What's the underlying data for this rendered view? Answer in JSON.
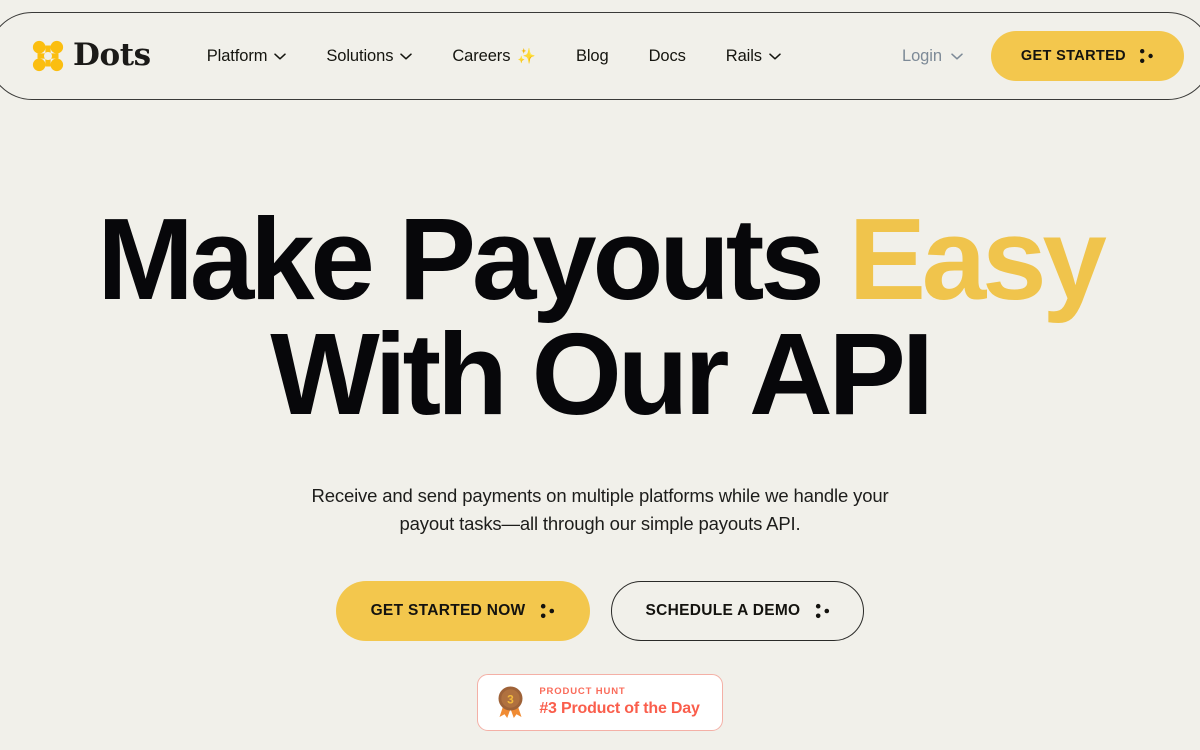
{
  "colors": {
    "page_background": "#F1F0EA",
    "accent_yellow": "#F3C74D",
    "headline_accent": "#F0C44C",
    "text_dark": "#07070A",
    "login_gray": "#7D8A97",
    "product_hunt_red": "#FA5E4C",
    "product_hunt_border": "#F4B0A6",
    "header_border": "#3A3A38"
  },
  "header": {
    "brand": {
      "name": "Dots",
      "logo_icon": "four-dots-cross-icon"
    },
    "nav": [
      {
        "label": "Platform",
        "has_dropdown": true,
        "icon": "chevron-down-icon",
        "emoji": ""
      },
      {
        "label": "Solutions",
        "has_dropdown": true,
        "icon": "chevron-down-icon",
        "emoji": ""
      },
      {
        "label": "Careers",
        "has_dropdown": false,
        "icon": "sparkles-icon",
        "emoji": "✨"
      },
      {
        "label": "Blog",
        "has_dropdown": false,
        "icon": "",
        "emoji": ""
      },
      {
        "label": "Docs",
        "has_dropdown": false,
        "icon": "",
        "emoji": ""
      },
      {
        "label": "Rails",
        "has_dropdown": true,
        "icon": "chevron-down-icon",
        "emoji": ""
      }
    ],
    "login": {
      "label": "Login",
      "icon": "chevron-down-icon"
    },
    "cta": {
      "label": "GET STARTED",
      "icon": "three-dots-icon"
    }
  },
  "hero": {
    "headline_line1_plain": "Make Payouts ",
    "headline_line1_accent": "Easy",
    "headline_line2": "With Our API",
    "subheadline": "Receive and send payments on multiple platforms while we handle your payout tasks—all through our simple payouts API.",
    "primary_cta": {
      "label": "GET STARTED NOW",
      "icon": "three-dots-icon"
    },
    "secondary_cta": {
      "label": "SCHEDULE A DEMO",
      "icon": "three-dots-icon"
    },
    "product_hunt_badge": {
      "kicker": "PRODUCT HUNT",
      "title": "#3 Product of the Day",
      "rank": "3",
      "icon": "product-hunt-medal-icon"
    }
  }
}
